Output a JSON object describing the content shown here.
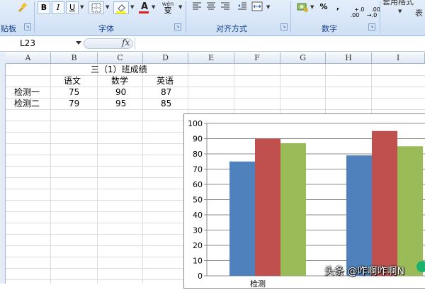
{
  "ribbon": {
    "paste_group_label": "贴板",
    "font_group_label": "字体",
    "align_group_label": "对齐方式",
    "number_group_label": "数字",
    "styles_label": "套用格式",
    "styles_sub_label": "表",
    "bold_label": "B",
    "italic_label": "I",
    "underline_label": "U",
    "font_color_label": "A",
    "phonetic_label": "wén\n变",
    "percent_label": "%",
    "comma_label": ",",
    "increase_decimal_label": "+.0\n.00",
    "decrease_decimal_label": ".00\n→.0",
    "icons": [
      "brush-icon",
      "border-icon",
      "fill-color-icon",
      "font-color-icon",
      "align-left-icon",
      "align-center-icon",
      "align-right-icon",
      "decrease-indent-icon",
      "merge-center-icon",
      "currency-icon"
    ]
  },
  "formula_bar": {
    "name_box": "L23",
    "fx_label": "fx",
    "formula": ""
  },
  "columns": [
    "A",
    "B",
    "C",
    "D",
    "E",
    "F",
    "G",
    "H",
    "I"
  ],
  "sheet": {
    "title": "三（1）班成绩",
    "header": [
      "语文",
      "数学",
      "英语"
    ],
    "rows": [
      {
        "label": "检测一",
        "values": [
          "75",
          "90",
          "87"
        ]
      },
      {
        "label": "检测二",
        "values": [
          "79",
          "95",
          "85"
        ]
      }
    ]
  },
  "chart_data": {
    "type": "bar",
    "categories": [
      "检测一",
      "检测二"
    ],
    "series": [
      {
        "values": [
          75,
          79
        ],
        "color": "#4f81bd"
      },
      {
        "values": [
          90,
          95
        ],
        "color": "#c0504d"
      },
      {
        "values": [
          87,
          85
        ],
        "color": "#9bbb59"
      }
    ],
    "ylim": [
      0,
      100
    ],
    "yticks": [
      "100",
      "90",
      "80",
      "70",
      "60",
      "50",
      "40",
      "30",
      "20",
      "10",
      "0"
    ],
    "grid": true,
    "visible_category_label": "检测"
  },
  "watermark": "头条 @咋啊咋啊N"
}
